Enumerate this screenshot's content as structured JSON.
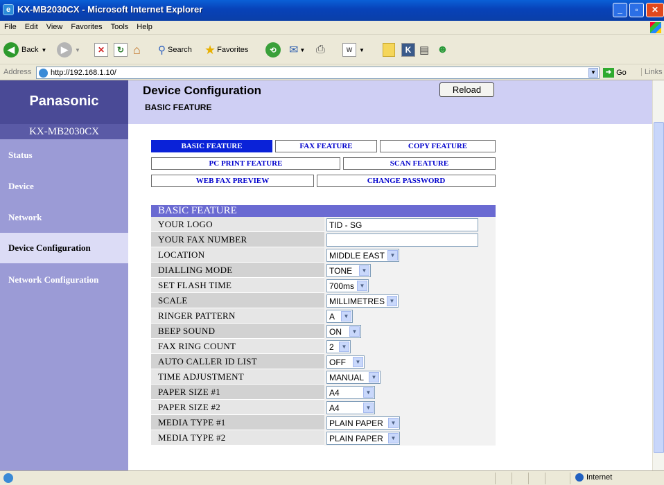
{
  "window": {
    "title": "KX-MB2030CX - Microsoft Internet Explorer"
  },
  "menu": [
    "File",
    "Edit",
    "View",
    "Favorites",
    "Tools",
    "Help"
  ],
  "toolbar": {
    "back": "Back",
    "search": "Search",
    "favorites": "Favorites"
  },
  "address": {
    "label": "Address",
    "url": "http://192.168.1.10/",
    "go": "Go",
    "links": "Links"
  },
  "sidebar": {
    "brand": "Panasonic",
    "model": "KX-MB2030CX",
    "items": [
      "Status",
      "Device",
      "Network",
      "Device Configuration",
      "Network Configuration"
    ],
    "active": "Device Configuration"
  },
  "header": {
    "title": "Device Configuration",
    "subtitle": "BASIC FEATURE",
    "reload": "Reload"
  },
  "tabs": [
    "BASIC FEATURE",
    "FAX FEATURE",
    "COPY FEATURE",
    "PC PRINT FEATURE",
    "SCAN FEATURE",
    "WEB FAX PREVIEW",
    "CHANGE PASSWORD"
  ],
  "section": {
    "title": "BASIC FEATURE",
    "rows": [
      {
        "label": "YOUR LOGO",
        "type": "text",
        "value": "TID - SG"
      },
      {
        "label": "YOUR FAX NUMBER",
        "type": "text",
        "value": ""
      },
      {
        "label": "LOCATION",
        "type": "select",
        "value": "MIDDLE EAST"
      },
      {
        "label": "DIALLING MODE",
        "type": "select",
        "value": "TONE"
      },
      {
        "label": "SET FLASH TIME",
        "type": "select",
        "value": "700ms"
      },
      {
        "label": "SCALE",
        "type": "select",
        "value": "MILLIMETRES"
      },
      {
        "label": "RINGER PATTERN",
        "type": "select",
        "value": "A"
      },
      {
        "label": "BEEP SOUND",
        "type": "select",
        "value": "ON"
      },
      {
        "label": "FAX RING COUNT",
        "type": "select",
        "value": "2"
      },
      {
        "label": "AUTO CALLER ID LIST",
        "type": "select",
        "value": "OFF"
      },
      {
        "label": "TIME ADJUSTMENT",
        "type": "select",
        "value": "MANUAL"
      },
      {
        "label": "PAPER SIZE #1",
        "type": "select",
        "value": "A4"
      },
      {
        "label": "PAPER SIZE #2",
        "type": "select",
        "value": "A4"
      },
      {
        "label": "MEDIA TYPE #1",
        "type": "select",
        "value": "PLAIN PAPER"
      },
      {
        "label": "MEDIA TYPE #2",
        "type": "select",
        "value": "PLAIN PAPER"
      }
    ]
  },
  "status": {
    "zone": "Internet"
  }
}
